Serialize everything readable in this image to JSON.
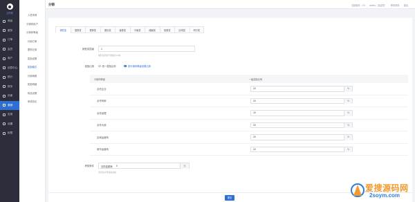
{
  "brand": {
    "name": "云商城"
  },
  "sidebar": {
    "items": [
      {
        "label": "商品",
        "icon": "box-icon"
      },
      {
        "label": "服务",
        "icon": "service-icon"
      },
      {
        "label": "订单",
        "icon": "order-icon"
      },
      {
        "label": "会员",
        "icon": "user-icon"
      },
      {
        "label": "商户",
        "icon": "store-icon"
      },
      {
        "label": "创意中心",
        "icon": "idea-icon"
      },
      {
        "label": "统计",
        "icon": "chart-icon"
      },
      {
        "label": "财务",
        "icon": "finance-icon"
      },
      {
        "label": "页面",
        "icon": "page-icon"
      },
      {
        "label": "营销",
        "icon": "marketing-icon",
        "active": true
      },
      {
        "label": "应用",
        "icon": "apps-icon"
      },
      {
        "label": "设置",
        "icon": "settings-icon"
      },
      {
        "label": "权限",
        "icon": "permission-icon"
      }
    ]
  },
  "subnav": {
    "items": [
      {
        "label": "入驻申请"
      },
      {
        "label": "分销商用户"
      },
      {
        "label": "分销商等级"
      },
      {
        "label": "分销订单"
      },
      {
        "label": "提现记录"
      },
      {
        "label": "奖励设置"
      },
      {
        "label": "奖励模式",
        "active": true
      },
      {
        "label": "分销海报"
      },
      {
        "label": "奖励明细"
      },
      {
        "label": "商品设置"
      },
      {
        "label": "申请协议"
      }
    ]
  },
  "header": {
    "title": "分销",
    "version": "当前版本：2.0",
    "user": "admin，欢迎您！",
    "edit_profile": "修改资料",
    "logout": "退出"
  },
  "tabs": [
    "销售奖",
    "直推奖",
    "推荐奖",
    "团队奖",
    "级差奖",
    "平级奖",
    "越级奖",
    "极差奖",
    "区域奖",
    "积分奖"
  ],
  "form": {
    "sales_label": "销售奖层级",
    "sales_value": "1",
    "sales_hint": "销售奖层级不能超过10级",
    "ratio_label": "奖励比例",
    "ratio_options": [
      "统一奖励比例",
      "按分销商等级设置比例"
    ],
    "ratio_selected": 1,
    "table": {
      "headers": [
        "分销商等级",
        "一级奖励比例"
      ],
      "rows": [
        {
          "level": "合作企业",
          "value": "15"
        },
        {
          "level": "合作商家",
          "value": "15"
        },
        {
          "level": "合作经理",
          "value": "15"
        },
        {
          "level": "合作大使",
          "value": "15"
        },
        {
          "level": "区域运营商",
          "value": "15"
        },
        {
          "level": "城市运营商",
          "value": "15"
        }
      ],
      "unit": "%"
    },
    "threshold_label": "考核条件",
    "threshold_prefix": "自购金额满",
    "threshold_value": "0",
    "threshold_unit": "元",
    "threshold_hint": "满足后才有收益资格",
    "submit": "提交"
  },
  "watermark": {
    "text1": "爱搜源码网",
    "text2": "2soym.com"
  }
}
